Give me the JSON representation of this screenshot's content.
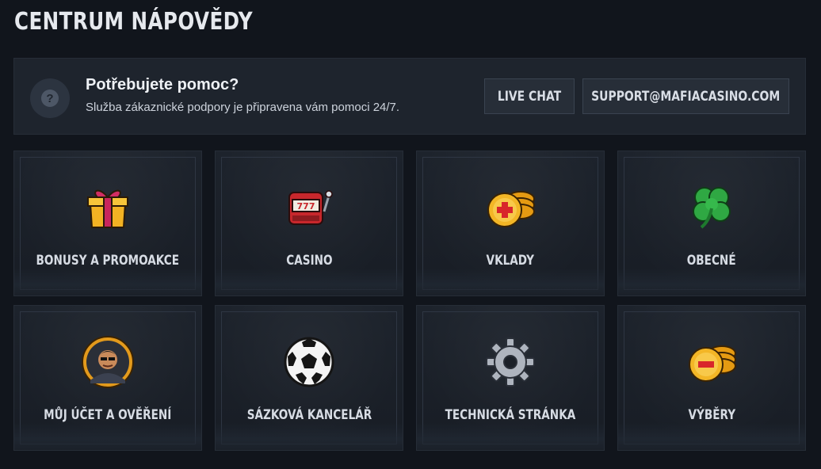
{
  "page": {
    "title": "CENTRUM NÁPOVĚDY"
  },
  "help": {
    "icon": "question-mark-icon",
    "icon_glyph": "?",
    "heading": "Potřebujete pomoc?",
    "text": "Služba zákaznické podpory je připravena vám pomoci 24/7.",
    "live_chat_label": "LIVE CHAT",
    "email_label": "SUPPORT@MAFIACASINO.COM"
  },
  "categories": [
    {
      "label": "BONUSY A PROMOAKCE",
      "icon": "gift-icon"
    },
    {
      "label": "CASINO",
      "icon": "slot-machine-icon"
    },
    {
      "label": "VKLADY",
      "icon": "coins-plus-icon"
    },
    {
      "label": "OBECNÉ",
      "icon": "clover-icon"
    },
    {
      "label": "MŮJ ÚČET A OVĚŘENÍ",
      "icon": "mafia-avatar-icon"
    },
    {
      "label": "SÁZKOVÁ KANCELÁŘ",
      "icon": "soccer-ball-icon"
    },
    {
      "label": "TECHNICKÁ STRÁNKA",
      "icon": "gear-icon"
    },
    {
      "label": "VÝBĚRY",
      "icon": "coins-minus-icon"
    }
  ],
  "colors": {
    "background": "#11151c",
    "panel": "#1e242d",
    "gold": "#f2b01e",
    "red": "#d8262a",
    "green": "#2fa843"
  }
}
